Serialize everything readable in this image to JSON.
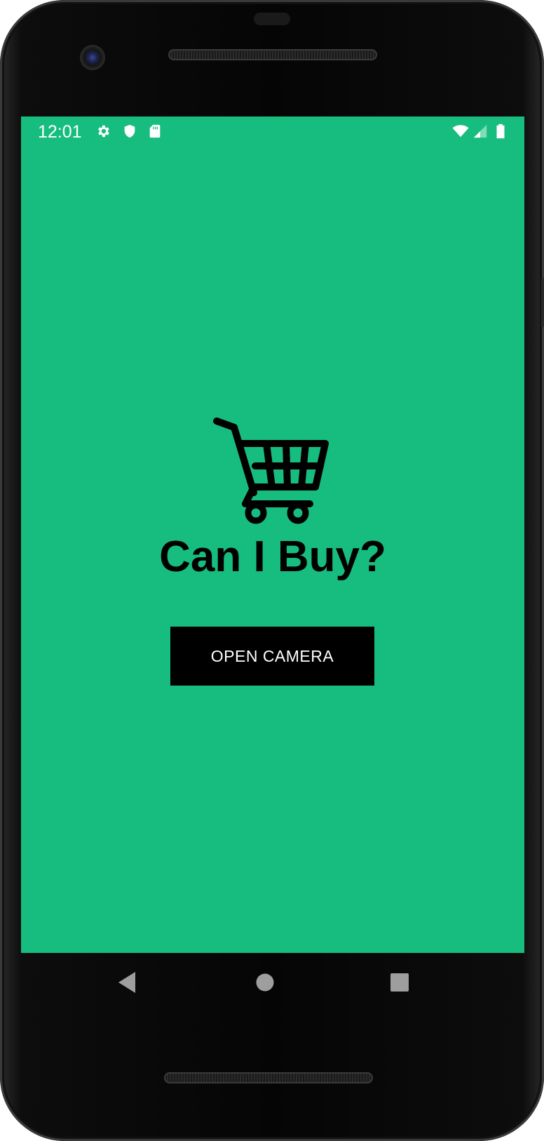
{
  "status_bar": {
    "time": "12:01",
    "left_icons": [
      "settings-icon",
      "shield-icon",
      "sd-card-icon"
    ],
    "right_icons": [
      "wifi-icon",
      "signal-icon",
      "battery-icon"
    ]
  },
  "app": {
    "background_color": "#17bd7f",
    "logo_icon": "shopping-cart-icon",
    "title": "Can I Buy?",
    "open_camera_label": "OPEN CAMERA"
  },
  "nav_bar": {
    "buttons": [
      "back-icon",
      "home-icon",
      "recents-icon"
    ]
  }
}
